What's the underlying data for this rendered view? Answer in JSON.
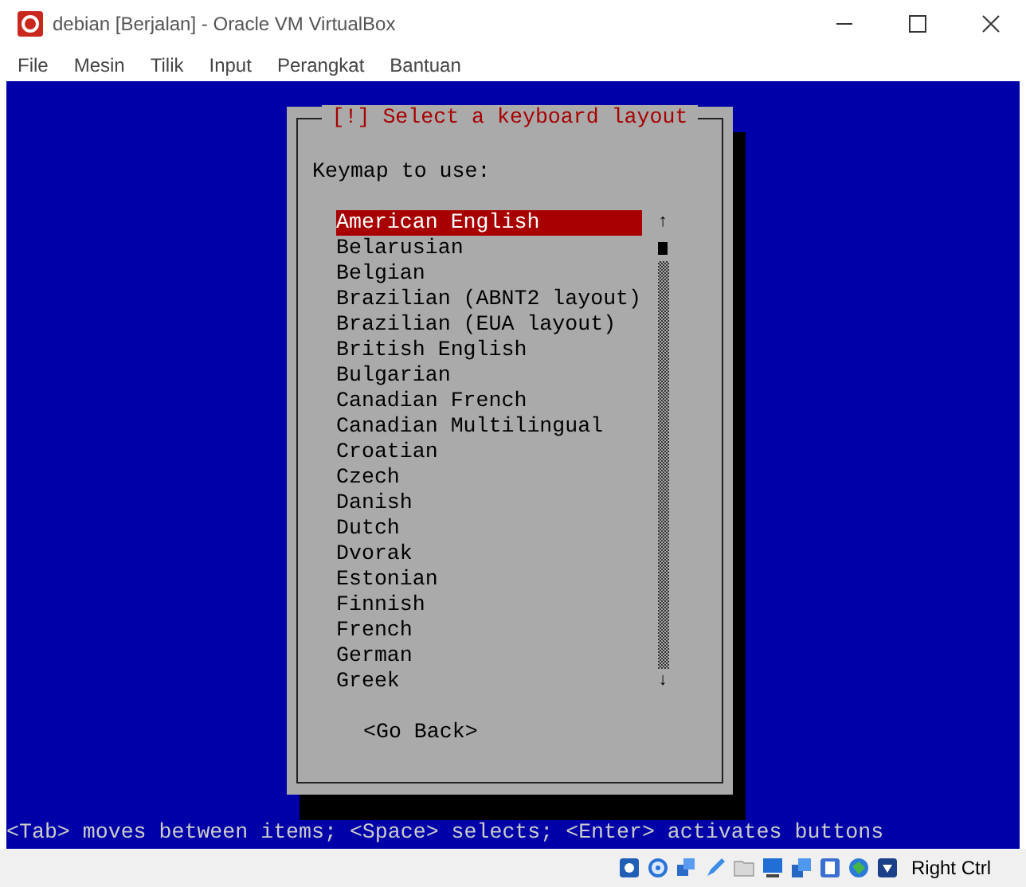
{
  "window": {
    "title": "debian [Berjalan] - Oracle VM VirtualBox"
  },
  "menu": [
    "File",
    "Mesin",
    "Tilik",
    "Input",
    "Perangkat",
    "Bantuan"
  ],
  "dialog": {
    "title": "[!] Select a keyboard layout",
    "prompt": "Keymap to use:",
    "items": [
      {
        "label": "American English",
        "selected": true
      },
      {
        "label": "Belarusian",
        "selected": false
      },
      {
        "label": "Belgian",
        "selected": false
      },
      {
        "label": "Brazilian (ABNT2 layout)",
        "selected": false
      },
      {
        "label": "Brazilian (EUA layout)",
        "selected": false
      },
      {
        "label": "British English",
        "selected": false
      },
      {
        "label": "Bulgarian",
        "selected": false
      },
      {
        "label": "Canadian French",
        "selected": false
      },
      {
        "label": "Canadian Multilingual",
        "selected": false
      },
      {
        "label": "Croatian",
        "selected": false
      },
      {
        "label": "Czech",
        "selected": false
      },
      {
        "label": "Danish",
        "selected": false
      },
      {
        "label": "Dutch",
        "selected": false
      },
      {
        "label": "Dvorak",
        "selected": false
      },
      {
        "label": "Estonian",
        "selected": false
      },
      {
        "label": "Finnish",
        "selected": false
      },
      {
        "label": "French",
        "selected": false
      },
      {
        "label": "German",
        "selected": false
      },
      {
        "label": "Greek",
        "selected": false
      }
    ],
    "scroll_up": "↑",
    "scroll_down": "↓",
    "button": "<Go Back>"
  },
  "help_line": "<Tab> moves between items; <Space> selects; <Enter> activates buttons",
  "status_bar": {
    "host_key": "Right Ctrl"
  }
}
